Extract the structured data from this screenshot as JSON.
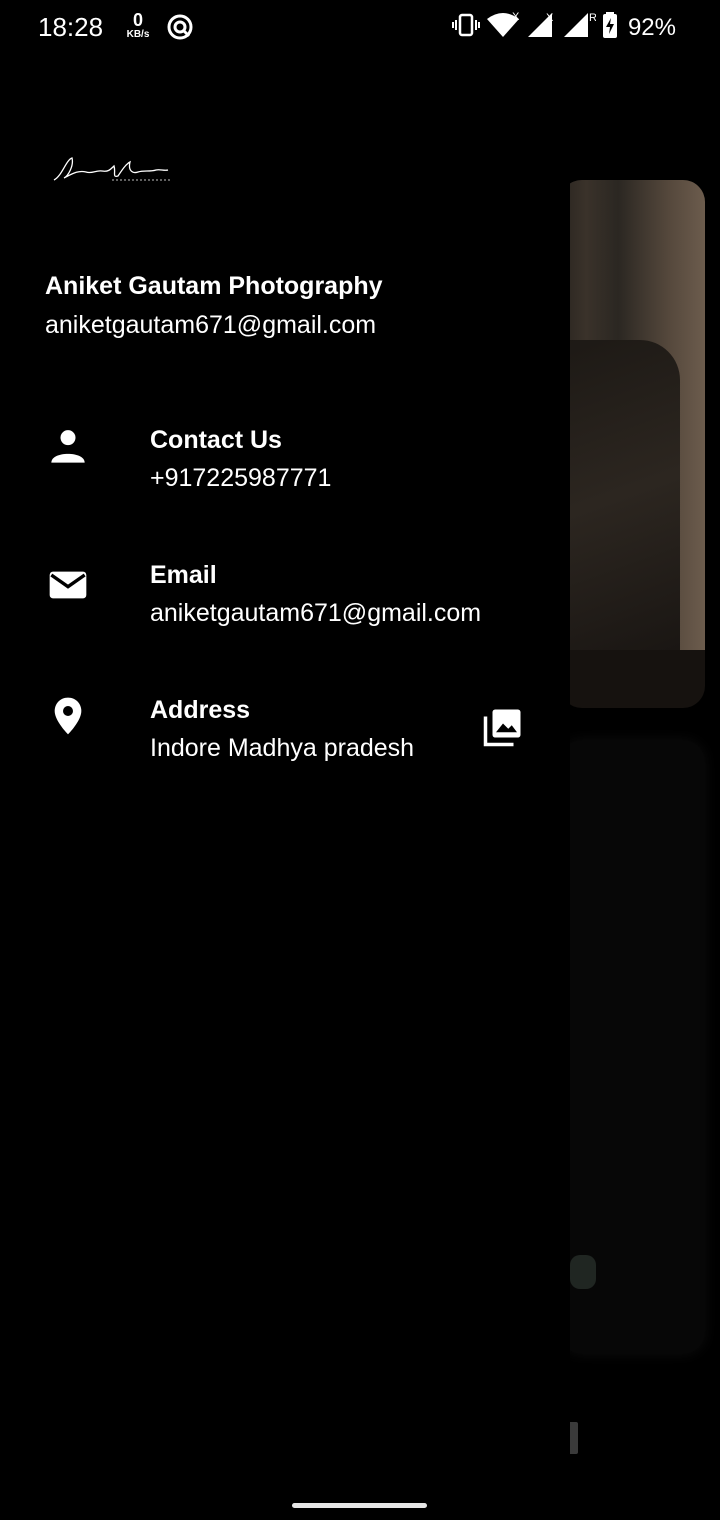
{
  "status_bar": {
    "time": "18:28",
    "net_speed_value": "0",
    "net_speed_unit": "KB/s",
    "battery_percent": "92%",
    "icons": [
      "vpn-icon",
      "vibrate-icon",
      "wifi-icon",
      "signal-icon",
      "signal-roaming-icon",
      "battery-charging-icon"
    ]
  },
  "drawer": {
    "logo_icon": "signature-logo",
    "header_title": "Aniket Gautam Photography",
    "header_email": "aniketgautam671@gmail.com",
    "items": [
      {
        "icon": "person-icon",
        "title": "Contact Us",
        "subtitle": "+917225987771"
      },
      {
        "icon": "email-icon",
        "title": "Email",
        "subtitle": "aniketgautam671@gmail.com"
      },
      {
        "icon": "location-pin-icon",
        "title": "Address",
        "subtitle": "Indore Madhya pradesh",
        "trailing_icon": "photo-library-icon"
      }
    ]
  },
  "colors": {
    "background": "#000000",
    "text": "#ffffff"
  }
}
